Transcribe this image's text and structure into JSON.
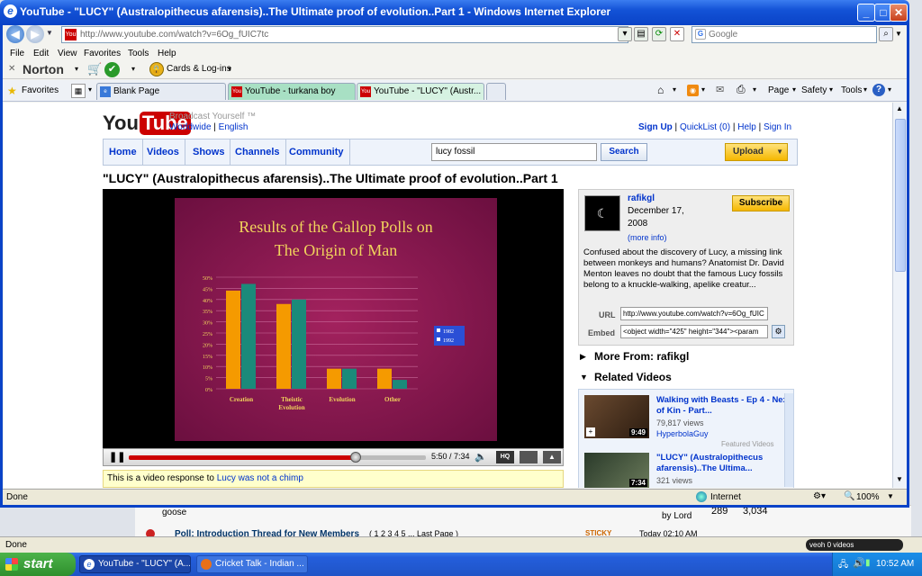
{
  "window": {
    "title": "YouTube - \"LUCY\" (Australopithecus afarensis)..The Ultimate proof of evolution..Part 1 - Windows Internet Explorer"
  },
  "address": {
    "url": "http://www.youtube.com/watch?v=6Og_fUIC7tc",
    "search_placeholder": "Google"
  },
  "menu": [
    "File",
    "Edit",
    "View",
    "Favorites",
    "Tools",
    "Help"
  ],
  "norton": {
    "brand": "Norton",
    "cards": "Cards & Log-ins"
  },
  "favbar": {
    "favorites": "Favorites",
    "tabs": [
      "Blank Page",
      "YouTube - turkana boy",
      "YouTube - \"LUCY\" (Austr..."
    ],
    "tools": [
      "Page",
      "Safety",
      "Tools"
    ]
  },
  "yt": {
    "logo_you": "You",
    "logo_tube": "Tube",
    "broadcast": "Broadcast Yourself ™",
    "worldwide": "Worldwide",
    "english": "English",
    "toplinks": [
      "Sign Up",
      "QuickList (0)",
      "Help",
      "Sign In"
    ],
    "nav": [
      "Home",
      "Videos",
      "Shows",
      "Channels",
      "Community"
    ],
    "search_value": "lucy fossil",
    "search_btn": "Search",
    "upload": "Upload",
    "video_title": "\"LUCY\" (Australopithecus afarensis)..The Ultimate proof of evolution..Part 1",
    "slide_title1": "Results of the Gallop Polls on",
    "slide_title2": "The Origin of Man",
    "time": "5:50 / 7:34",
    "response_prefix": "This is a video response to",
    "response_link": "Lucy was not a chimp",
    "user": "rafikgl",
    "date1": "December 17,",
    "date2": "2008",
    "more_info": "(more info)",
    "subscribe": "Subscribe",
    "description": "Confused about the discovery of Lucy, a missing link between monkeys and humans? Anatomist Dr. David Menton leaves no doubt that the famous Lucy fossils belong to a knuckle-walking, apelike creatur...",
    "url_label": "URL",
    "url_value": "http://www.youtube.com/watch?v=6Og_fUIC",
    "embed_label": "Embed",
    "embed_value": "<object width=\"425\" height=\"344\"><param",
    "more_from": "More From: rafikgl",
    "related_title": "Related Videos",
    "related": [
      {
        "title": "Walking with Beasts - Ep 4 - Next of Kin - Part...",
        "views": "79,817 views",
        "user": "HyperbolaGuy",
        "dur": "9:49"
      },
      {
        "title": "\"LUCY\" (Australopithecus afarensis)..The Ultima...",
        "views": "321 views",
        "dur": "7:34"
      }
    ],
    "featured": "Featured Videos"
  },
  "status": {
    "done": "Done",
    "zone": "Internet",
    "zoom": "100%"
  },
  "behind": {
    "row1": "goose",
    "row1b": "by Lord",
    "n1": "289",
    "n2": "3,034",
    "poll": "Poll: Introduction Thread for New Members",
    "pages": "( 1 2 3 4 5 ... Last Page )",
    "sticky": "STICKY",
    "today": "Today 02:10 AM",
    "done2": "Done",
    "veoh": "veoh",
    "videos": "0 videos"
  },
  "taskbar": {
    "start": "start",
    "items": [
      "YouTube - \"LUCY\" (A...",
      "Cricket Talk - Indian ..."
    ],
    "clock": "10:52 AM"
  },
  "chart_data": {
    "type": "bar",
    "title": "Results of the Gallop Polls on The Origin of Man",
    "categories": [
      "Creation",
      "Theistic Evolution",
      "Evolution",
      "Other"
    ],
    "series": [
      {
        "name": "1982",
        "values": [
          44,
          38,
          9,
          9
        ],
        "color": "#f59a00"
      },
      {
        "name": "1992",
        "values": [
          47,
          40,
          9,
          4
        ],
        "color": "#1b8a7a"
      }
    ],
    "yticks": [
      "0%",
      "5%",
      "10%",
      "15%",
      "20%",
      "25%",
      "30%",
      "35%",
      "40%",
      "45%",
      "50%"
    ],
    "ylim": [
      0,
      50
    ]
  }
}
